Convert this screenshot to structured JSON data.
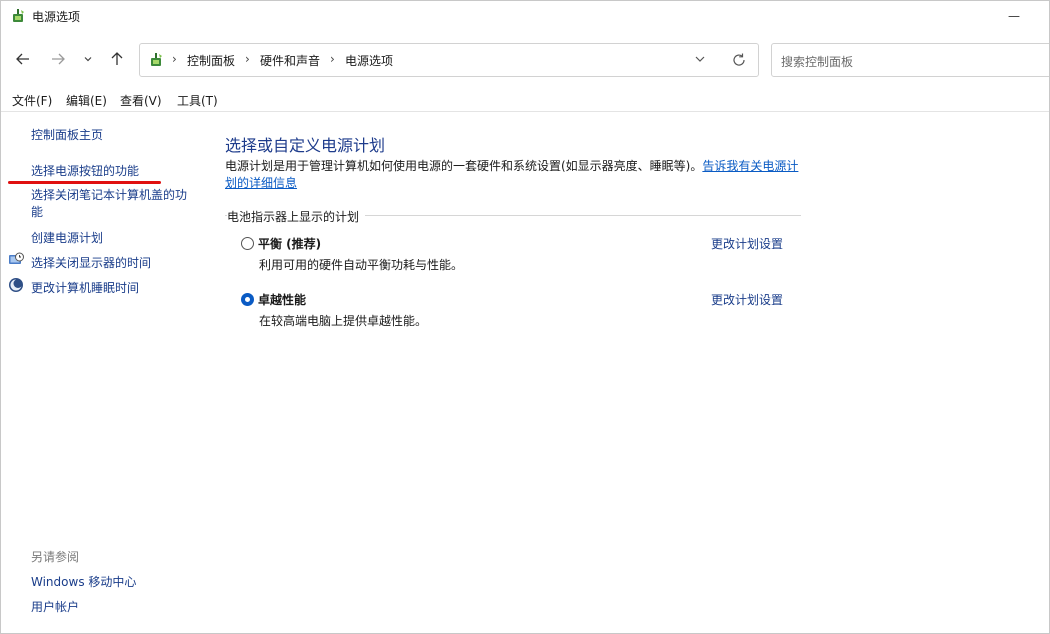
{
  "window": {
    "title": "电源选项",
    "minimize_glyph": "—",
    "icon": "power-options-icon"
  },
  "nav": {
    "back_icon": "arrow-left-icon",
    "forward_icon": "arrow-right-icon",
    "recent_icon": "chevron-down-icon",
    "up_icon": "arrow-up-icon",
    "breadcrumbs": [
      "控制面板",
      "硬件和声音",
      "电源选项"
    ],
    "search_placeholder": "搜索控制面板"
  },
  "menu": {
    "items": [
      "文件(F)",
      "编辑(E)",
      "查看(V)",
      "工具(T)"
    ]
  },
  "left": {
    "home": "控制面板主页",
    "links": [
      "选择电源按钮的功能",
      "选择关闭笔记本计算机盖的功能",
      "创建电源计划",
      "选择关闭显示器的时间",
      "更改计算机睡眠时间"
    ],
    "see_also_label": "另请参阅",
    "see_also_links": [
      "Windows 移动中心",
      "用户帐户"
    ],
    "annotation_color": "#e01010"
  },
  "main": {
    "title": "选择或自定义电源计划",
    "description": "电源计划是用于管理计算机如何使用电源的一套硬件和系统设置(如显示器亮度、睡眠等)。",
    "description_link": "告诉我有关电源计划的详细信息",
    "section_label": "电池指示器上显示的计划",
    "plans": [
      {
        "name": "平衡 (推荐)",
        "description": "利用可用的硬件自动平衡功耗与性能。",
        "link": "更改计划设置",
        "selected": false
      },
      {
        "name": "卓越性能",
        "description": "在较高端电脑上提供卓越性能。",
        "link": "更改计划设置",
        "selected": true
      }
    ]
  },
  "colors": {
    "link": "#1a3d8a",
    "title": "#1e3c8c",
    "accent": "#0a5bc4"
  }
}
